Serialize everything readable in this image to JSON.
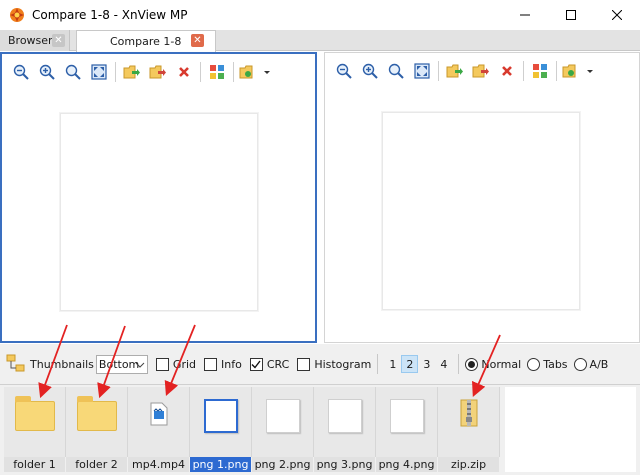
{
  "window": {
    "title": "Compare 1-8 - XnView MP",
    "controls": [
      "minimize-icon",
      "maximize-icon",
      "close-icon"
    ]
  },
  "tabs": [
    {
      "label": "Browser",
      "active": false
    },
    {
      "label": "Compare 1-8",
      "active": true
    }
  ],
  "panels": [
    {
      "name": "left",
      "active": true,
      "toolbar": [
        "zoom-out-icon",
        "zoom-in-icon",
        "zoom-reset-icon",
        "fit-icon",
        "copy-to-icon",
        "move-to-icon",
        "delete-icon",
        "compare-icon",
        "folder-menu-icon"
      ]
    },
    {
      "name": "right",
      "active": false,
      "toolbar": [
        "zoom-out-icon",
        "zoom-in-icon",
        "zoom-reset-icon",
        "fit-icon",
        "copy-to-icon",
        "move-to-icon",
        "delete-icon",
        "compare-icon",
        "folder-menu-icon"
      ]
    }
  ],
  "options": {
    "thumbnails_label": "Thumbnails",
    "thumbnails_position": "Bottom",
    "grid_label": "Grid",
    "grid_checked": false,
    "info_label": "Info",
    "info_checked": false,
    "crc_label": "CRC",
    "crc_checked": true,
    "histogram_label": "Histogram",
    "histogram_checked": false,
    "pages": [
      "1",
      "2",
      "3",
      "4"
    ],
    "selected_page": "2",
    "modes": [
      "Normal",
      "Tabs",
      "A/B"
    ],
    "selected_mode": "Normal"
  },
  "thumbnails": [
    {
      "label": "folder 1",
      "type": "folder",
      "selected": false
    },
    {
      "label": "folder 2",
      "type": "folder",
      "selected": false
    },
    {
      "label": "mp4.mp4",
      "type": "video",
      "selected": false
    },
    {
      "label": "png 1.png",
      "type": "image",
      "selected": true
    },
    {
      "label": "png 2.png",
      "type": "image",
      "selected": false
    },
    {
      "label": "png 3.png",
      "type": "image",
      "selected": false
    },
    {
      "label": "png 4.png",
      "type": "image",
      "selected": false
    },
    {
      "label": "zip.zip",
      "type": "zip",
      "selected": false
    }
  ],
  "colors": {
    "accent": "#2d6ad1",
    "active_panel_border": "#3a6fc0",
    "annotation_arrow": "#e32222"
  }
}
